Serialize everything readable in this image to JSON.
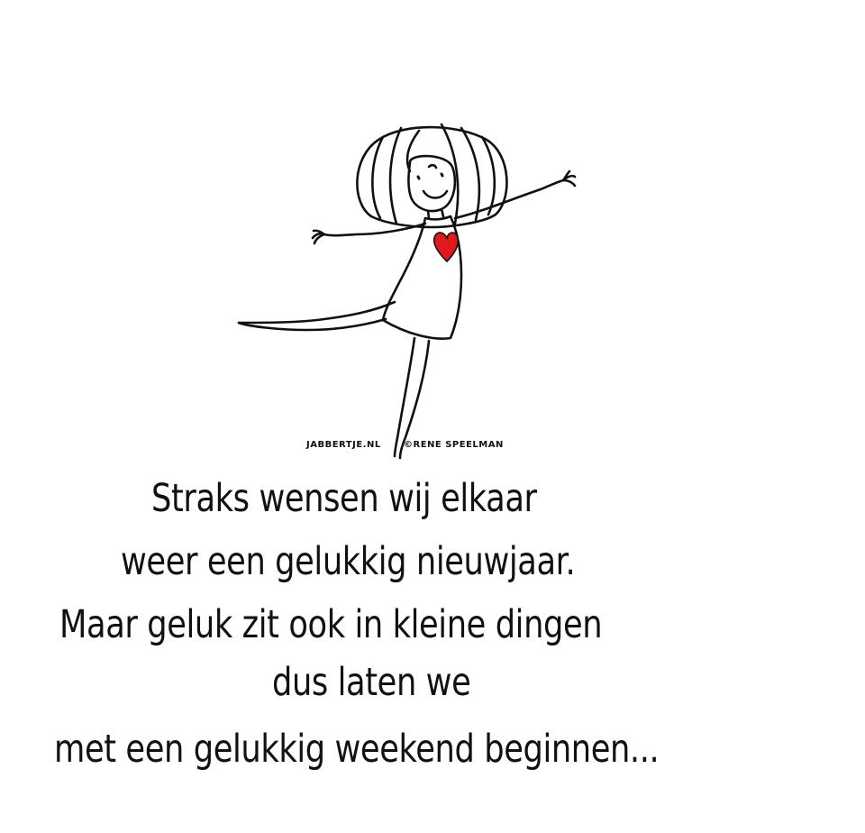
{
  "credits": {
    "site": "JABBERTJE.NL",
    "copyright": "©RENE SPEELMAN"
  },
  "poem": {
    "lines": [
      "Straks wensen wij elkaar",
      "weer een gelukkig nieuwjaar.",
      "Maar geluk zit ook in kleine dingen",
      "dus laten we",
      "met een gelukkig weekend beginnen..."
    ]
  },
  "colors": {
    "background": "#ffffff",
    "ink": "#111111",
    "heart": "#e0191f"
  },
  "icons": {
    "figure": "dancing-girl-illustration",
    "heart": "heart-icon"
  }
}
